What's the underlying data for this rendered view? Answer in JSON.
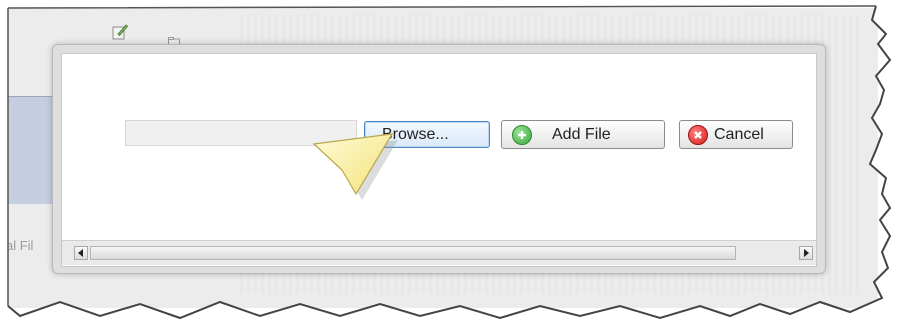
{
  "background": {
    "partial_tab_label": "al Fil"
  },
  "dialog": {
    "file_input": {
      "value": "",
      "placeholder": ""
    },
    "buttons": {
      "browse_label": "Browse...",
      "add_file_label": "Add File",
      "cancel_label": "Cancel"
    },
    "icons": {
      "add": "plus-circle-icon",
      "cancel": "x-circle-icon",
      "scroll_left": "arrow-left-icon",
      "scroll_right": "arrow-right-icon",
      "pointer": "callout-arrow-icon"
    }
  },
  "colors": {
    "browse_border": "#4a86c8",
    "add_icon": "#3aa53a",
    "cancel_icon": "#d41a1a",
    "callout": "#fff3a8"
  }
}
